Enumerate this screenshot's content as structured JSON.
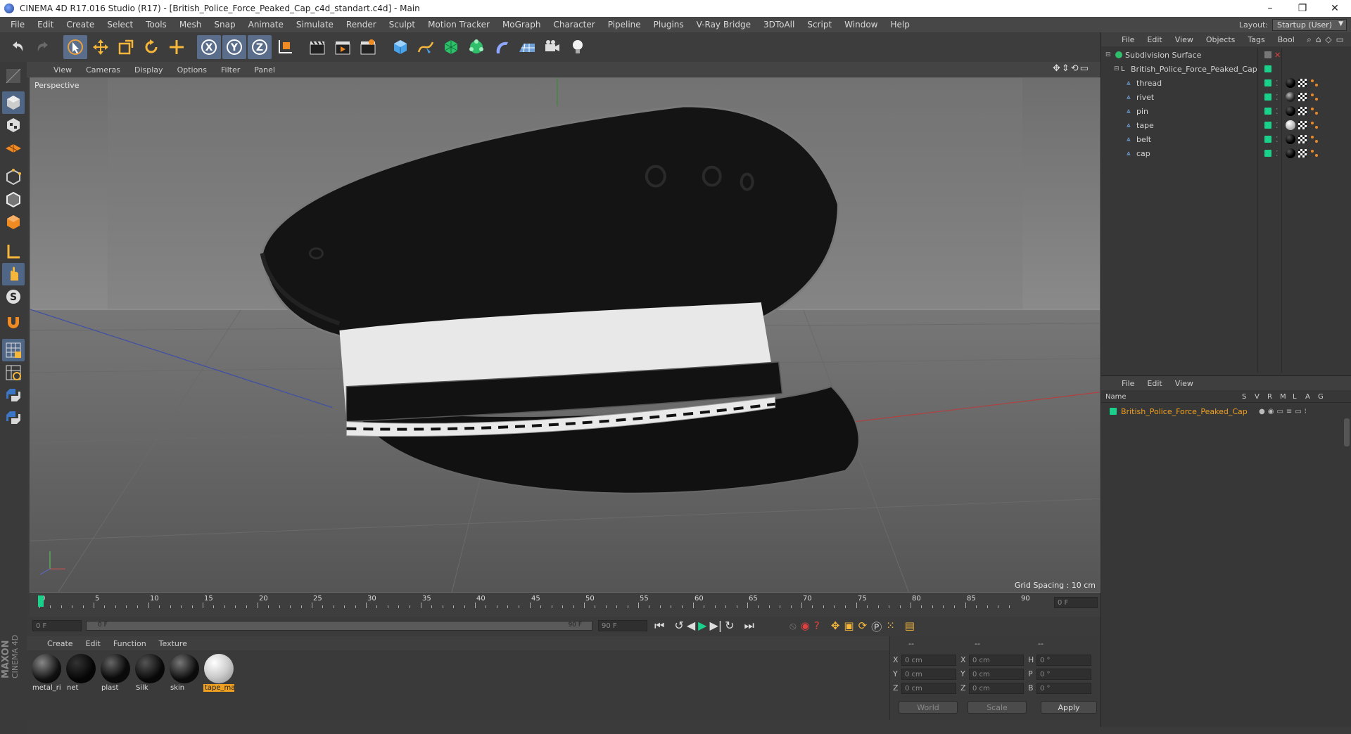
{
  "window": {
    "title": "CINEMA 4D R17.016 Studio (R17) - [British_Police_Force_Peaked_Cap_c4d_standart.c4d] - Main",
    "controls": [
      "–",
      "❐",
      "✕"
    ]
  },
  "menubar": {
    "items": [
      "File",
      "Edit",
      "Create",
      "Select",
      "Tools",
      "Mesh",
      "Snap",
      "Animate",
      "Simulate",
      "Render",
      "Sculpt",
      "Motion Tracker",
      "MoGraph",
      "Character",
      "Pipeline",
      "Plugins",
      "V-Ray Bridge",
      "3DToAll",
      "Script",
      "Window",
      "Help"
    ]
  },
  "layout": {
    "label": "Layout:",
    "value": "Startup (User)"
  },
  "viewport": {
    "menu": [
      "View",
      "Cameras",
      "Display",
      "Options",
      "Filter",
      "Panel"
    ],
    "camera_label": "Perspective",
    "grid_spacing": "Grid Spacing : 10 cm"
  },
  "timeline": {
    "ticks": [
      "0",
      "5",
      "10",
      "15",
      "20",
      "25",
      "30",
      "35",
      "40",
      "45",
      "50",
      "55",
      "60",
      "65",
      "70",
      "75",
      "80",
      "85",
      "90"
    ],
    "current_frame": "0 F",
    "start_field": "0 F",
    "range_start": "0 F",
    "range_end": "90 F",
    "end_field": "90 F"
  },
  "materials": {
    "menu": [
      "Create",
      "Edit",
      "Function",
      "Texture"
    ],
    "items": [
      {
        "name": "metal_ri",
        "selected": false
      },
      {
        "name": "net",
        "selected": false
      },
      {
        "name": "plast",
        "selected": false
      },
      {
        "name": "Silk",
        "selected": false
      },
      {
        "name": "skin",
        "selected": false
      },
      {
        "name": "tape_ma",
        "selected": true
      }
    ],
    "brand_top": "MAXON",
    "brand_bottom": "CINEMA 4D"
  },
  "coordinates": {
    "headers": [
      "--",
      "--",
      "--"
    ],
    "rows": [
      {
        "a_label": "X",
        "a_value": "0 cm",
        "b_label": "X",
        "b_value": "0 cm",
        "c_label": "H",
        "c_value": "0 °"
      },
      {
        "a_label": "Y",
        "a_value": "0 cm",
        "b_label": "Y",
        "b_value": "0 cm",
        "c_label": "P",
        "c_value": "0 °"
      },
      {
        "a_label": "Z",
        "a_value": "0 cm",
        "b_label": "Z",
        "b_value": "0 cm",
        "c_label": "B",
        "c_value": "0 °"
      }
    ],
    "mode_world": "World",
    "mode_scale": "Scale",
    "apply": "Apply"
  },
  "objects": {
    "menu": [
      "File",
      "Edit",
      "View",
      "Objects",
      "Tags",
      "Bool"
    ],
    "root": "Subdivision Surface",
    "group": "British_Police_Force_Peaked_Cap",
    "children": [
      {
        "name": "thread",
        "material": "black"
      },
      {
        "name": "rivet",
        "material": "metal"
      },
      {
        "name": "pin",
        "material": "black"
      },
      {
        "name": "tape",
        "material": "white"
      },
      {
        "name": "belt",
        "material": "black"
      },
      {
        "name": "cap",
        "material": "black"
      }
    ]
  },
  "layers": {
    "menu": [
      "File",
      "Edit",
      "View"
    ],
    "columns": [
      "Name",
      "S",
      "V",
      "R",
      "M",
      "L",
      "A",
      "G"
    ],
    "row": "British_Police_Force_Peaked_Cap"
  },
  "colors": {
    "accent_green": "#19d18a",
    "selection_orange": "#f0a020",
    "ui_dark": "#3b3b3b"
  }
}
